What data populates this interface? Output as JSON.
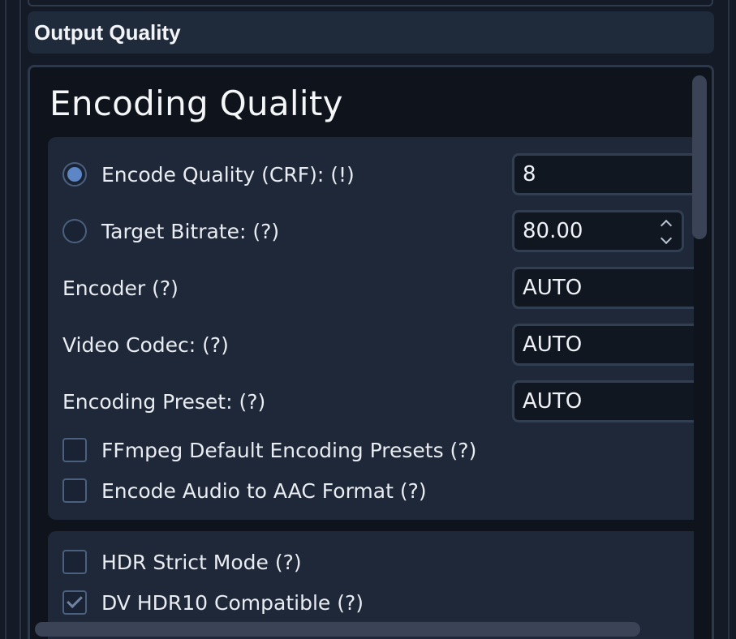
{
  "header": {
    "title": "Output Quality"
  },
  "panel": {
    "title": "Encoding Quality",
    "encode_quality": {
      "label": "Encode Quality (CRF): (!)",
      "value": "8",
      "selected": true
    },
    "target_bitrate": {
      "label": "Target Bitrate: (?)",
      "value": "80.00",
      "selected": false
    },
    "encoder": {
      "label": "Encoder (?)",
      "value": "AUTO"
    },
    "video_codec": {
      "label": "Video Codec: (?)",
      "value": "AUTO"
    },
    "encoding_preset": {
      "label": "Encoding Preset: (?)",
      "value": "AUTO"
    },
    "ffmpeg_presets": {
      "label": "FFmpeg Default Encoding Presets (?)",
      "checked": false
    },
    "encode_audio_aac": {
      "label": "Encode Audio to AAC Format (?)",
      "checked": false
    },
    "hdr_strict": {
      "label": "HDR Strict Mode (?)",
      "checked": false
    },
    "dv_hdr10": {
      "label": "DV HDR10 Compatible (?)",
      "checked": true
    }
  },
  "colors": {
    "background": "#151b26",
    "card": "#1e2838",
    "accent": "#5d86c7"
  }
}
